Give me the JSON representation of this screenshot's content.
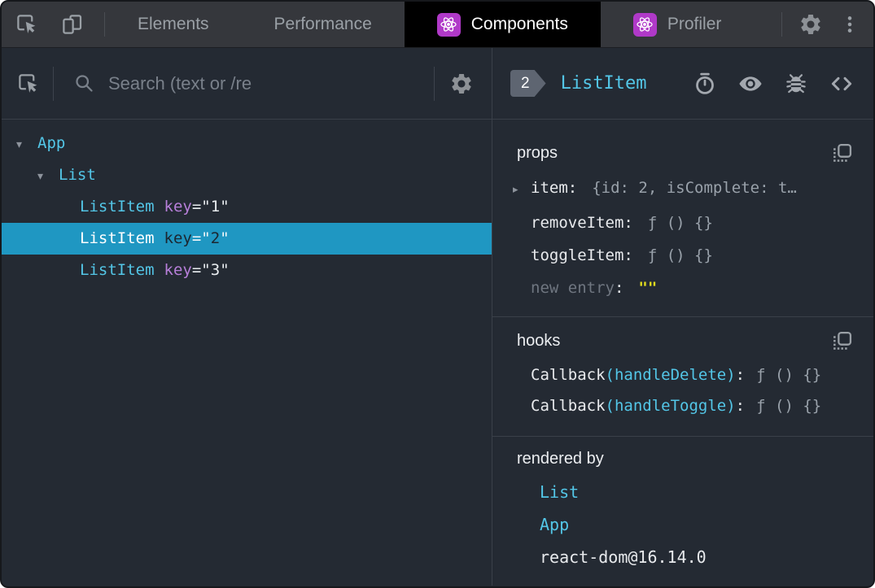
{
  "topbar": {
    "tabs": [
      {
        "label": "Elements",
        "active": false,
        "icon": null
      },
      {
        "label": "Performance",
        "active": false,
        "icon": null
      },
      {
        "label": "Components",
        "active": true,
        "icon": "react"
      },
      {
        "label": "Profiler",
        "active": false,
        "icon": "react"
      }
    ]
  },
  "left": {
    "search_placeholder": "Search (text or /re",
    "tree": [
      {
        "depth": 0,
        "name": "App",
        "children": true,
        "selected": false
      },
      {
        "depth": 1,
        "name": "List",
        "children": true,
        "selected": false
      },
      {
        "depth": 2,
        "name": "ListItem",
        "key": "1",
        "children": false,
        "selected": false
      },
      {
        "depth": 2,
        "name": "ListItem",
        "key": "2",
        "children": false,
        "selected": true
      },
      {
        "depth": 2,
        "name": "ListItem",
        "key": "3",
        "children": false,
        "selected": false
      }
    ]
  },
  "right": {
    "badge": "2",
    "component": "ListItem",
    "sections": {
      "props": {
        "title": "props",
        "rows": [
          {
            "name": "item",
            "value": "{id: 2, isComplete: t…",
            "expandable": true,
            "editable": false
          },
          {
            "name": "removeItem",
            "value": "ƒ () {}",
            "expandable": false,
            "editable": false
          },
          {
            "name": "toggleItem",
            "value": "ƒ () {}",
            "expandable": false,
            "editable": false
          },
          {
            "name": "new entry",
            "value": "\"\"",
            "expandable": false,
            "editable": true
          }
        ]
      },
      "hooks": {
        "title": "hooks",
        "rows": [
          {
            "name": "Callback",
            "paren": "(handleDelete)",
            "value": "ƒ () {}"
          },
          {
            "name": "Callback",
            "paren": "(handleToggle)",
            "value": "ƒ () {}"
          }
        ]
      },
      "rendered_by": {
        "title": "rendered by",
        "items": [
          {
            "label": "List",
            "link": true
          },
          {
            "label": "App",
            "link": true
          },
          {
            "label": "react-dom@16.14.0",
            "link": false
          }
        ]
      }
    }
  },
  "colors": {
    "selection_bg": "#1f97c2",
    "component_name": "#53c6e7",
    "key_attr": "#b77fd9",
    "editable_yellow": "#e0db1e",
    "react_badge": "#b039c8",
    "panel_bg": "#242a33",
    "toolbar_bg": "#35373c",
    "active_tab_bg": "#000000",
    "text_primary": "#e8eaed",
    "text_secondary": "#9aa0a6",
    "value_dim": "#99a1aa"
  }
}
